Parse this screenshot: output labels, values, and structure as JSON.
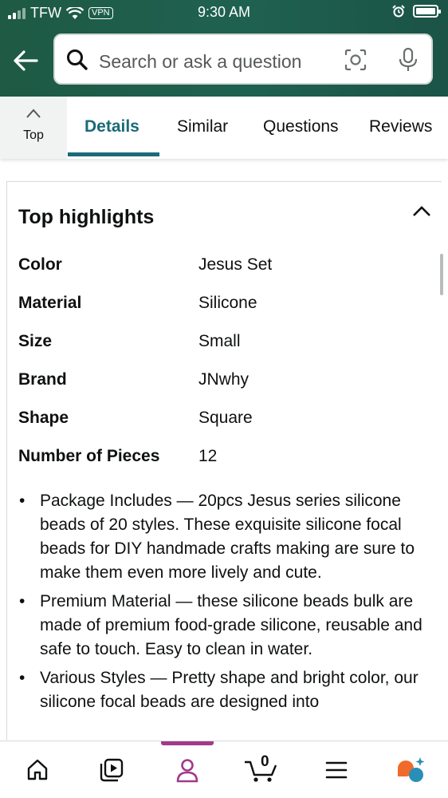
{
  "status_bar": {
    "carrier": "TFW",
    "vpn": "VPN",
    "time": "9:30 AM"
  },
  "search": {
    "placeholder": "Search or ask a question"
  },
  "tabs": {
    "top_label": "Top",
    "items": [
      "Details",
      "Similar",
      "Questions",
      "Reviews"
    ],
    "active": "Details"
  },
  "highlights": {
    "title": "Top highlights",
    "specs": [
      {
        "key": "Color",
        "value": "Jesus Set"
      },
      {
        "key": "Material",
        "value": "Silicone"
      },
      {
        "key": "Size",
        "value": "Small"
      },
      {
        "key": "Brand",
        "value": "JNwhy"
      },
      {
        "key": "Shape",
        "value": "Square"
      },
      {
        "key": "Number of Pieces",
        "value": "12"
      }
    ],
    "bullets": [
      "Package Includes — 20pcs Jesus series silicone beads of 20 styles. These exquisite silicone focal beads for DIY handmade crafts making are sure to make them even more lively and cute.",
      "Premium Material — these silicone beads bulk are made of premium food-grade silicone, reusable and safe to touch. Easy to clean in water.",
      "Various Styles — Pretty shape and bright color, our silicone focal beads are designed into"
    ]
  },
  "bottom_nav": {
    "items": [
      "home-icon",
      "video-icon",
      "account-icon",
      "cart-icon",
      "menu-icon",
      "ai-assistant-icon"
    ],
    "cart_count": "0",
    "active": "account-icon"
  },
  "colors": {
    "header": "#1f6150",
    "accent": "#1b6a7a",
    "nav_indicator": "#a23a8a"
  }
}
